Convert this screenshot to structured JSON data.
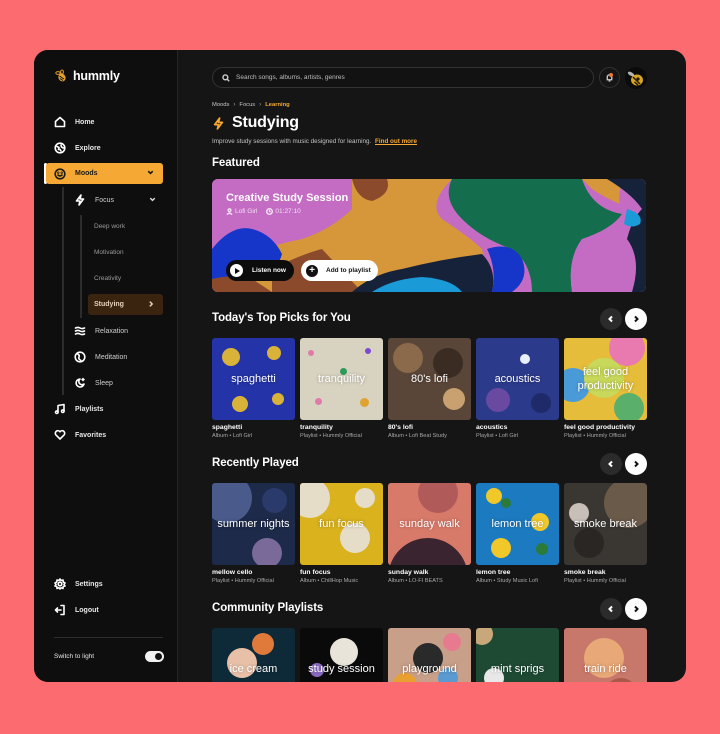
{
  "app": {
    "name": "hummly"
  },
  "sidebar": {
    "items": [
      {
        "label": "Home",
        "icon": "home-icon"
      },
      {
        "label": "Explore",
        "icon": "compass-icon"
      },
      {
        "label": "Moods",
        "icon": "smile-icon",
        "active": true
      },
      {
        "label": "Playlists",
        "icon": "music-note-icon"
      },
      {
        "label": "Favorites",
        "icon": "heart-icon"
      }
    ],
    "moods_children": [
      {
        "label": "Focus",
        "icon": "lightning-icon",
        "expanded": true
      },
      {
        "label": "Relaxation",
        "icon": "waves-icon"
      },
      {
        "label": "Meditation",
        "icon": "yin-yang-icon"
      },
      {
        "label": "Sleep",
        "icon": "moon-stars-icon"
      }
    ],
    "focus_children": [
      "Deep work",
      "Motivation",
      "Creativity",
      "Studying"
    ],
    "active_leaf": "Studying",
    "footer": [
      {
        "label": "Settings",
        "icon": "gear-icon"
      },
      {
        "label": "Logout",
        "icon": "logout-icon"
      }
    ],
    "theme_toggle": {
      "label": "Switch to light",
      "on": true
    }
  },
  "header": {
    "search_placeholder": "Search songs, albums, artists, genres",
    "notifications_unread": true
  },
  "breadcrumb": [
    "Moods",
    "Focus",
    "Learning"
  ],
  "page": {
    "title": "Studying",
    "description": "Improve study sessions with music designed for learning.",
    "link": "Find out more"
  },
  "featured": {
    "heading": "Featured",
    "title": "Creative Study Session",
    "artist": "Lofi Girl",
    "duration": "01:27:10",
    "listen_label": "Listen now",
    "add_label": "Add to playlist"
  },
  "sections": [
    {
      "title": "Today's Top Picks for You",
      "cards": [
        {
          "cover_text": "spaghetti",
          "title": "spaghetti",
          "subtitle": "Album • Lofi Girl"
        },
        {
          "cover_text": "tranquility",
          "title": "tranquility",
          "subtitle": "Playlist • Hummly Official"
        },
        {
          "cover_text": "80's lofi",
          "title": "80's lofi",
          "subtitle": "Album • Lofi Beat Study"
        },
        {
          "cover_text": "acoustics",
          "title": "acoustics",
          "subtitle": "Playlist • Lofi Girl"
        },
        {
          "cover_text": "feel good productivity",
          "title": "feel good productivity",
          "subtitle": "Playlist • Hummly Official"
        }
      ]
    },
    {
      "title": "Recently Played",
      "cards": [
        {
          "cover_text": "summer nights",
          "title": "mellow cello",
          "subtitle": "Playlist • Hummly Official"
        },
        {
          "cover_text": "fun focus",
          "title": "fun focus",
          "subtitle": "Album • ChillHop Music"
        },
        {
          "cover_text": "sunday walk",
          "title": "sunday walk",
          "subtitle": "Album • LO-FI BEATS"
        },
        {
          "cover_text": "lemon tree",
          "title": "lemon tree",
          "subtitle": "Album • Study Music Lofi"
        },
        {
          "cover_text": "smoke break",
          "title": "smoke break",
          "subtitle": "Playlist • Hummly Official"
        }
      ]
    },
    {
      "title": "Community Playlists",
      "cards": [
        {
          "cover_text": "ice cream"
        },
        {
          "cover_text": "study session"
        },
        {
          "cover_text": "playground"
        },
        {
          "cover_text": "mint sprigs"
        },
        {
          "cover_text": "train ride"
        }
      ]
    }
  ],
  "colors": {
    "accent": "#f5a833",
    "background": "#fc6b70",
    "surface": "#151515",
    "sidebar": "#0e0e0e"
  }
}
